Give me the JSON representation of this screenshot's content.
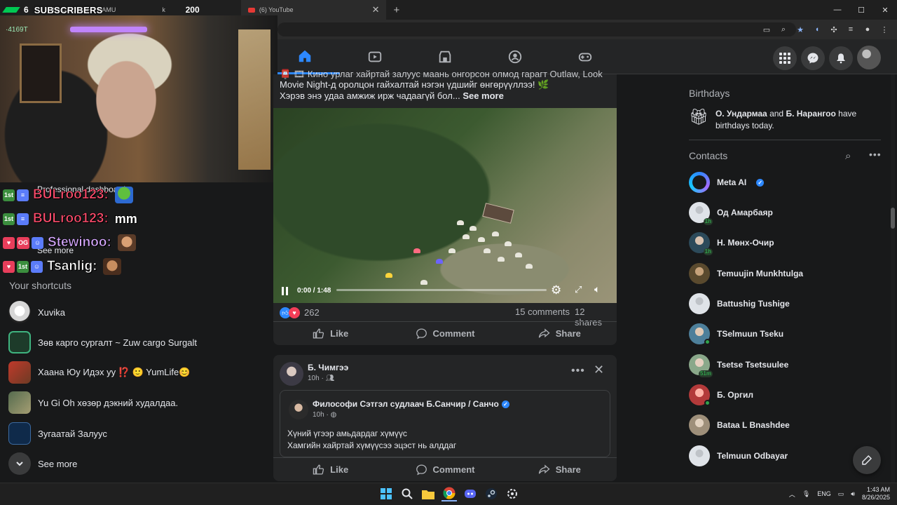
{
  "browser": {
    "tab_inactive": "The GALTMAH - NAMU",
    "tab_inactive_suffix": "k",
    "tab_active": "(6) YouTube",
    "new_tab": "+",
    "win_controls": [
      "—",
      "☐",
      "✕"
    ]
  },
  "stream": {
    "sub_count": "6",
    "sub_label": "SUBSCRIBERS",
    "sub_goal": "200",
    "cam_tag": "·4169T",
    "accent_color": "#00c853"
  },
  "chat": [
    {
      "badges": [
        "1st",
        "≡"
      ],
      "user": "BULroo123:",
      "user_color": "#ff4d6d",
      "message": "",
      "emote": "pepe"
    },
    {
      "badges": [
        "1st",
        "≡"
      ],
      "user": "BULroo123:",
      "user_color": "#ff4d6d",
      "message": "mm",
      "emote": ""
    },
    {
      "badges": [
        "♥",
        "OG",
        "☺"
      ],
      "user": "Stewinoo:",
      "user_color": "#d6a8ff",
      "message": "",
      "emote": "face"
    },
    {
      "badges": [
        "♥",
        "1st",
        "☺"
      ],
      "user": "Tsanlig:",
      "user_color": "#ffffff",
      "message": "",
      "emote": "face"
    }
  ],
  "left_sidebar": {
    "professional_dashboard": "Professional dashboard",
    "see_more_top": "See more",
    "shortcuts_title": "Your shortcuts",
    "shortcuts": [
      {
        "label": "Xuvika"
      },
      {
        "label": "Зөв карго сургалт ~ Zuw cargo Surgalt"
      },
      {
        "label": "Хаана Юу Идэх уу ⁉️ 🙂 YumLife😊"
      },
      {
        "label": "Yu Gi Oh хөзөр дэкний худалдаа."
      },
      {
        "label": "Зугаатай Залуус"
      }
    ],
    "see_more": "See more"
  },
  "post1": {
    "text_line1": "📮 🎞 Кино урлаг хайртай залуус маань онгорсон олмод гарагт Outlaw, Look",
    "text_line2": "Movie Night-д оролцон гайхалтай нэгэн үдшийг өнгөрүүллээ! 🌿",
    "text_line3": "Хэрэв энэ удаа амжиж ирж чадаагүй бол...",
    "see_more": "See more",
    "video_time": "0:00 / 1:48",
    "video_progress": 0.0,
    "reactions_count": "262",
    "comments": "15 comments",
    "shares": "12 shares",
    "actions": {
      "like": "Like",
      "comment": "Comment",
      "share": "Share"
    }
  },
  "post2": {
    "author": "Б. Чимгээ",
    "time": "10h ·",
    "shared_page": "Философи Сэтгэл судлаач Б.Санчир / Санчо",
    "shared_time": "10h ·",
    "text_line1": "Хүний үгээр амьдардаг хүмүүс",
    "text_line2": "Хамгийн хайртай хүмүүсээ эцэст нь алддаг",
    "actions": {
      "like": "Like",
      "comment": "Comment",
      "share": "Share"
    }
  },
  "right": {
    "birthdays_title": "Birthdays",
    "birthday_name1": "О. Ундармаа",
    "birthday_and": " and ",
    "birthday_name2": "Б. Нарангоо",
    "birthday_rest": " have birthdays today.",
    "contacts_title": "Contacts",
    "contacts": [
      {
        "name": "Meta AI",
        "status": "verified"
      },
      {
        "name": "Од Амарбаяр",
        "status": "1h"
      },
      {
        "name": "Н. Мөнх-Очир",
        "status": "1h"
      },
      {
        "name": "Temuujin Munkhtulga",
        "status": ""
      },
      {
        "name": "Battushig Tushige",
        "status": ""
      },
      {
        "name": "TSelmuun Tseku",
        "status": "online"
      },
      {
        "name": "Tsetse Tsetsuulee",
        "status": "51m"
      },
      {
        "name": "Б. Оргил",
        "status": "online"
      },
      {
        "name": "Bataa L Bnashdee",
        "status": ""
      },
      {
        "name": "Telmuun Odbayar",
        "status": ""
      }
    ]
  },
  "taskbar": {
    "lang": "ENG",
    "time": "1:43 AM",
    "date": "8/26/2025"
  },
  "colors": {
    "fb_blue": "#2d88ff",
    "surface": "#242526",
    "background": "#18191a"
  }
}
